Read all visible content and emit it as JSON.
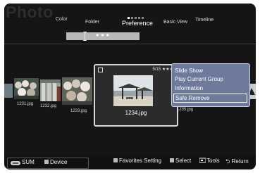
{
  "header": {
    "app_title": "Photo",
    "tabs": [
      {
        "label": "Color",
        "selected": false
      },
      {
        "label": "Folder",
        "selected": false
      },
      {
        "label": "Preference",
        "selected": true
      },
      {
        "label": "Basic View",
        "selected": false
      },
      {
        "label": "Timeline",
        "selected": false
      }
    ],
    "page_dots": {
      "total": 5,
      "active": 1
    }
  },
  "preference_bar": {
    "label": "★★★"
  },
  "thumbnails": [
    {
      "label": "1231.jpg"
    },
    {
      "label": "1232.jpg"
    },
    {
      "label": "1233.jpg"
    },
    {
      "label": "1234.jpg",
      "focused": true,
      "counter": "5/15 ★★★"
    },
    {
      "label": "1235.jpg"
    }
  ],
  "context_menu": {
    "items": [
      {
        "label": "Slide Show"
      },
      {
        "label": "Play Current Group"
      },
      {
        "label": "Information"
      },
      {
        "label": "Safe Remove",
        "highlighted": true
      }
    ]
  },
  "bottom_bar": {
    "sum_label": "SUM",
    "device_label": "Device",
    "favorites_label": "Favorites Setting",
    "select_label": "Select",
    "tools_label": "Tools",
    "return_label": "Return"
  },
  "colors": {
    "background": "#151515",
    "menu": "#6d7a9c",
    "bar": "#b8b8b8"
  }
}
